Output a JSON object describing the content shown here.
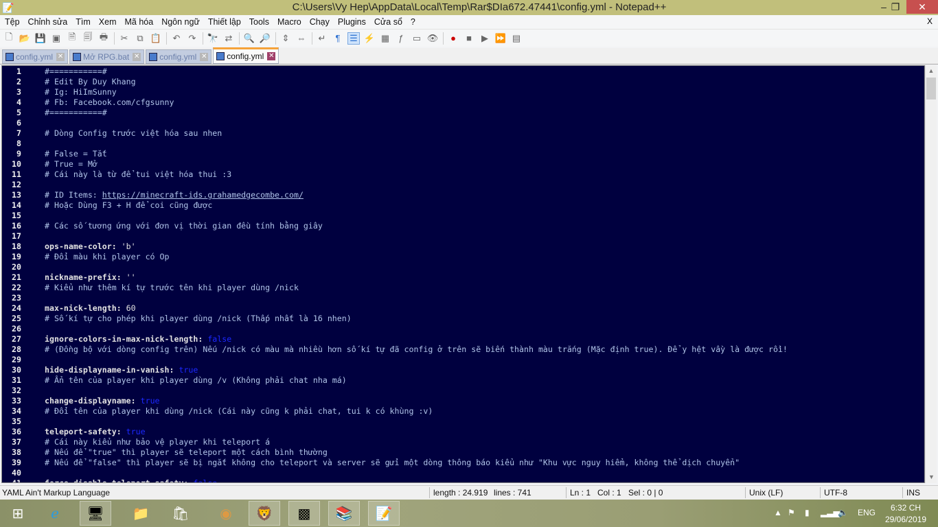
{
  "window": {
    "title": "C:\\Users\\Vy Hep\\AppData\\Local\\Temp\\Rar$DIa672.47441\\config.yml - Notepad++",
    "minimize": "‒",
    "restore": "❐",
    "close": "✕"
  },
  "menu": {
    "items": [
      "Tệp",
      "Chỉnh sửa",
      "Tìm",
      "Xem",
      "Mã hóa",
      "Ngôn ngữ",
      "Thiết lập",
      "Tools",
      "Macro",
      "Chạy",
      "Plugins",
      "Cửa sổ",
      "?"
    ],
    "close": "X"
  },
  "toolbar": {
    "icons": [
      "new-file",
      "open-file",
      "save",
      "save-all",
      "close",
      "close-all",
      "print",
      "|",
      "cut",
      "copy",
      "paste",
      "|",
      "undo",
      "redo",
      "|",
      "find",
      "replace",
      "|",
      "zoom-in",
      "zoom-out",
      "|",
      "sync-vertical",
      "sync-horizontal",
      "|",
      "word-wrap",
      "show-all-chars",
      "indent-guide",
      "user-defined-language",
      "document-map",
      "function-list",
      "folder-as-workspace",
      "monitoring",
      "|",
      "record-macro",
      "stop-recording",
      "playback",
      "run-macro-multiple",
      "save-macro"
    ],
    "active": "indent-guide"
  },
  "tabs": [
    {
      "label": "config.yml",
      "active": false
    },
    {
      "label": "Mở RPG.bat",
      "active": false
    },
    {
      "label": "config.yml",
      "active": false
    },
    {
      "label": "config.yml",
      "active": true
    }
  ],
  "editor": {
    "colors": {
      "background": "#00003f",
      "comment": "#b0c4e8",
      "key": "#e2e2e2",
      "boolean": "#1c28ff"
    },
    "lines": [
      {
        "c": "#===========#"
      },
      {
        "c": "# Edit By Duy Khang"
      },
      {
        "c": "# Ig: HiImSunny"
      },
      {
        "c": "# Fb: Facebook.com/cfgsunny"
      },
      {
        "c": "#===========#"
      },
      {},
      {
        "c": "# Dòng Config trước việt hóa sau nhen"
      },
      {},
      {
        "c": "# False = Tắt"
      },
      {
        "c": "# True = Mở"
      },
      {
        "c": "# Cái này là từ để tui việt hóa thui :3"
      },
      {},
      {
        "c": "# ID Items: ",
        "url": "https://minecraft-ids.grahamedgecombe.com/"
      },
      {
        "c": "# Hoặc Dùng F3 + H để coi cũng được"
      },
      {},
      {
        "c": "# Các số tương ứng với đơn vị thời gian đều tính bằng giây"
      },
      {},
      {
        "k": "ops-name-color:",
        "v": " 'b'"
      },
      {
        "c": "# Đổi màu khi player có Op"
      },
      {},
      {
        "k": "nickname-prefix:",
        "v": " ''"
      },
      {
        "c": "# Kiểu như thêm kí tự trước tên khi player dùng /nick"
      },
      {},
      {
        "k": "max-nick-length:",
        "v": " 60"
      },
      {
        "c": "# Số kí tự cho phép khi player dùng /nick (Thấp nhất là 16 nhen)"
      },
      {},
      {
        "k": "ignore-colors-in-max-nick-length:",
        "b": " false"
      },
      {
        "c": "# (Đồng bộ với dòng config trên) Nếu /nick có màu mà nhiều hơn số kí tự đã config ở trên sẽ biến thành màu trắng (Mặc định true). Để y hệt vầy là được rồi!"
      },
      {},
      {
        "k": "hide-displayname-in-vanish:",
        "b": " true"
      },
      {
        "c": "# Ẩn tên của player khi player dùng /v (Không phải chat nha má)"
      },
      {},
      {
        "k": "change-displayname:",
        "b": " true"
      },
      {
        "c": "# Đổi tên của player khi dùng /nick (Cái này cũng k phải chat, tui k có khùng :v)"
      },
      {},
      {
        "k": "teleport-safety:",
        "b": " true"
      },
      {
        "c": "# Cái này kiểu như bảo vệ player khi teleport á"
      },
      {
        "c": "# Nếu để \"true\" thì player sẽ teleport một cách bình thường"
      },
      {
        "c": "# Nếu để \"false\" thì player sẽ bị ngắt không cho teleport và server sẽ gửi một dòng thông báo kiểu như \"Khu vực nguy hiểm, không thể dịch chuyển\""
      },
      {},
      {
        "k": "force-disable-teleport-safety:",
        "b": " false"
      }
    ]
  },
  "status": {
    "language": "YAML Ain't Markup Language",
    "length": "length : 24.919",
    "lines": "lines : 741",
    "ln": "Ln : 1",
    "col": "Col : 1",
    "sel": "Sel : 0 | 0",
    "eol": "Unix (LF)",
    "encoding": "UTF-8",
    "mode": "INS"
  },
  "taskbar": {
    "apps": [
      {
        "icon": "windows-start",
        "open": false
      },
      {
        "icon": "internet-explorer",
        "open": false
      },
      {
        "icon": "remote-desktop",
        "open": true
      },
      {
        "icon": "file-explorer",
        "open": false
      },
      {
        "icon": "windows-store",
        "open": false
      },
      {
        "icon": "chrome",
        "open": false
      },
      {
        "icon": "brave",
        "open": true
      },
      {
        "icon": "minecraft",
        "open": true
      },
      {
        "icon": "winrar",
        "open": true
      },
      {
        "icon": "notepad-plus-plus",
        "open": true
      }
    ],
    "tray": {
      "language": "ENG",
      "time": "6:32 CH",
      "date": "29/06/2019"
    }
  }
}
